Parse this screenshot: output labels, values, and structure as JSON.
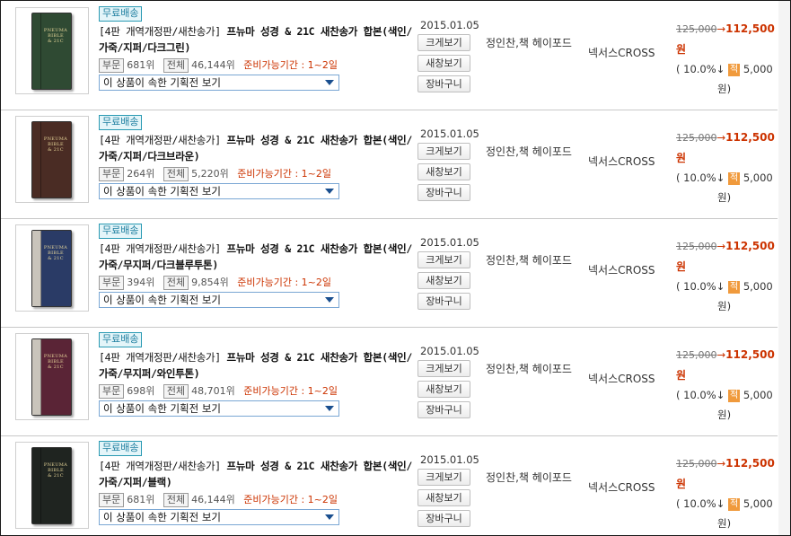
{
  "common": {
    "free_shipping": "무료배송",
    "rank_part": "부문",
    "rank_total": "전체",
    "select_text": "이 상품이 속한 기획전 보기",
    "btn_preview": "크게보기",
    "btn_new_window": "새창보기",
    "btn_cart": "장바구니",
    "date": "2015.01.05",
    "author": "정인찬,책 헤이포드",
    "publisher": "넥서스CROSS",
    "price_original": "125,000",
    "price_arrow": "→",
    "price_sale": "112,500원",
    "discount": "( 10.0%↓",
    "point_badge": "적",
    "points": "5,000",
    "points_end": "원)"
  },
  "items": [
    {
      "title_prefix": "[4판 개역개정판/새찬송가]",
      "title": " 프뉴마 성경 & 21C 새찬송가 합본(색인/가죽/지퍼/다크그린)",
      "rank_part": "681위",
      "rank_total": "46,144위",
      "availability": "준비가능기간 : 1~2일",
      "cover_color": "#2f4a33",
      "spine_color": "#2f4a33"
    },
    {
      "title_prefix": "[4판 개역개정판/새찬송가]",
      "title": " 프뉴마 성경 & 21C 새찬송가 합본(색인/가죽/지퍼/다크브라운)",
      "rank_part": "264위",
      "rank_total": "5,220위",
      "availability": "준비가능기간 : 1~2일",
      "cover_color": "#4a2c24",
      "spine_color": "#4a2c24"
    },
    {
      "title_prefix": "[4판 개역개정판/새찬송가]",
      "title": " 프뉴마 성경 & 21C 새찬송가 합본(색인/가죽/무지퍼/다크블루투톤)",
      "rank_part": "394위",
      "rank_total": "9,854위",
      "availability": "준비가능기간 : 1~2일",
      "cover_color": "#2a3b66",
      "spine_color": "#c9c4bb"
    },
    {
      "title_prefix": "[4판 개역개정판/새찬송가]",
      "title": " 프뉴마 성경 & 21C 새찬송가 합본(색인/가죽/무지퍼/와인투톤)",
      "rank_part": "698위",
      "rank_total": "48,701위",
      "availability": "준비가능기간 : 1~2일",
      "cover_color": "#5a2436",
      "spine_color": "#c9c4bb"
    },
    {
      "title_prefix": "[4판 개역개정판/새찬송가]",
      "title": " 프뉴마 성경 & 21C 새찬송가 합본(색인/가죽/지퍼/블랙)",
      "rank_part": "681위",
      "rank_total": "46,144위",
      "availability": "준비가능기간 : 1~2일",
      "cover_color": "#1f2420",
      "spine_color": "#1f2420"
    }
  ]
}
